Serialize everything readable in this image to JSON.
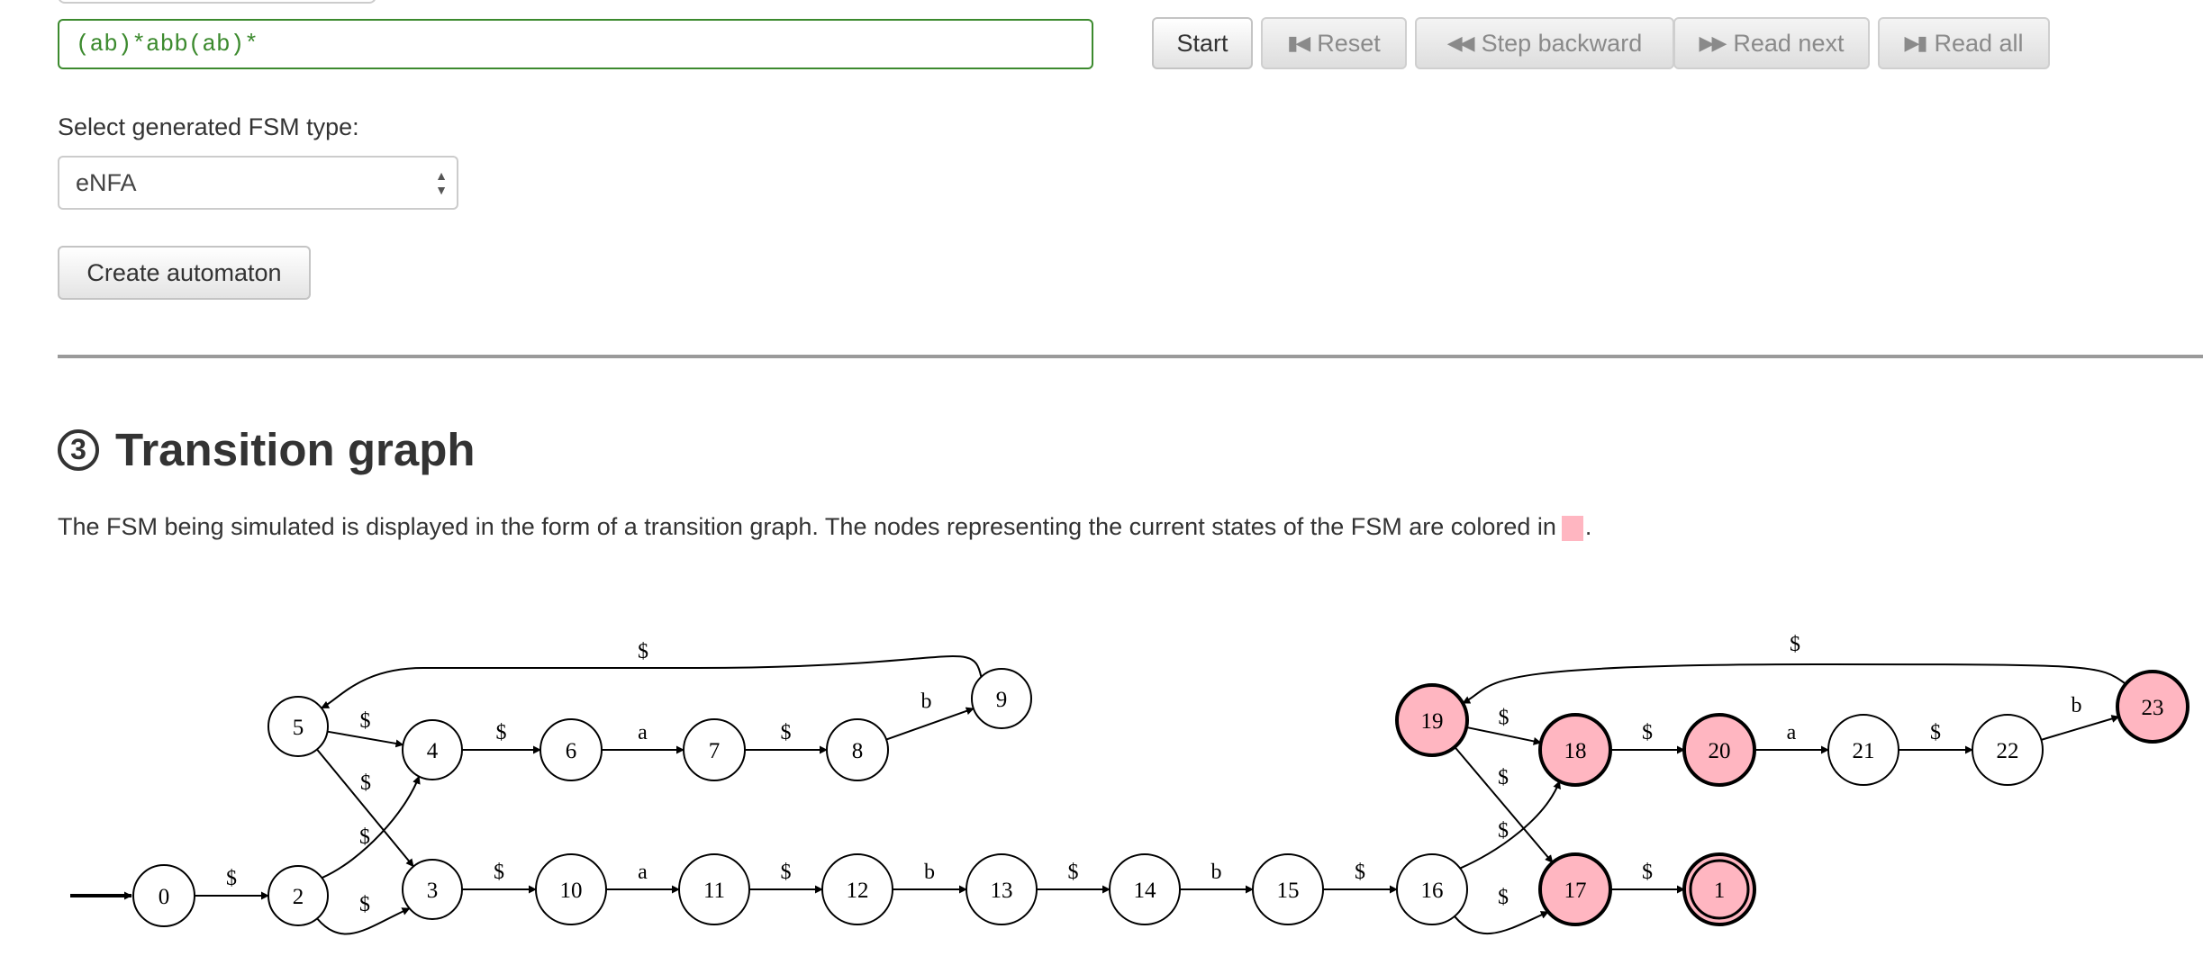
{
  "regex_input": {
    "value": "(ab)*abb(ab)*"
  },
  "controls": {
    "start": "Start",
    "reset": "Reset",
    "step_backward": "Step backward",
    "read_next": "Read next",
    "read_all": "Read all"
  },
  "fsm_type": {
    "label": "Select generated FSM type:",
    "selected": "eNFA"
  },
  "create_button": "Create automaton",
  "section": {
    "number": "③",
    "title": "Transition graph",
    "description": "The FSM being simulated is displayed in the form of a transition graph. The nodes representing the current states of the FSM are colored in",
    "description_end": "."
  },
  "colors": {
    "current_state": "#ffb6c1",
    "accent_green": "#3c8a2e"
  },
  "graph": {
    "nodes": [
      {
        "id": "0",
        "current": false,
        "accepting": false
      },
      {
        "id": "2",
        "current": false,
        "accepting": false
      },
      {
        "id": "5",
        "current": false,
        "accepting": false
      },
      {
        "id": "4",
        "current": false,
        "accepting": false
      },
      {
        "id": "6",
        "current": false,
        "accepting": false
      },
      {
        "id": "7",
        "current": false,
        "accepting": false
      },
      {
        "id": "8",
        "current": false,
        "accepting": false
      },
      {
        "id": "9",
        "current": false,
        "accepting": false
      },
      {
        "id": "3",
        "current": false,
        "accepting": false
      },
      {
        "id": "10",
        "current": false,
        "accepting": false
      },
      {
        "id": "11",
        "current": false,
        "accepting": false
      },
      {
        "id": "12",
        "current": false,
        "accepting": false
      },
      {
        "id": "13",
        "current": false,
        "accepting": false
      },
      {
        "id": "14",
        "current": false,
        "accepting": false
      },
      {
        "id": "15",
        "current": false,
        "accepting": false
      },
      {
        "id": "16",
        "current": false,
        "accepting": false
      },
      {
        "id": "19",
        "current": true,
        "accepting": false
      },
      {
        "id": "18",
        "current": true,
        "accepting": false
      },
      {
        "id": "20",
        "current": true,
        "accepting": false
      },
      {
        "id": "21",
        "current": false,
        "accepting": false
      },
      {
        "id": "22",
        "current": false,
        "accepting": false
      },
      {
        "id": "23",
        "current": true,
        "accepting": false
      },
      {
        "id": "17",
        "current": true,
        "accepting": false
      },
      {
        "id": "1",
        "current": true,
        "accepting": true
      }
    ],
    "edges": [
      {
        "from": "0",
        "to": "2",
        "label": "$"
      },
      {
        "from": "2",
        "to": "4",
        "label": "$"
      },
      {
        "from": "2",
        "to": "3",
        "label": "$"
      },
      {
        "from": "5",
        "to": "4",
        "label": "$"
      },
      {
        "from": "5",
        "to": "3",
        "label": "$"
      },
      {
        "from": "4",
        "to": "6",
        "label": "$"
      },
      {
        "from": "6",
        "to": "7",
        "label": "a"
      },
      {
        "from": "7",
        "to": "8",
        "label": "$"
      },
      {
        "from": "8",
        "to": "9",
        "label": "b"
      },
      {
        "from": "9",
        "to": "5",
        "label": "$"
      },
      {
        "from": "3",
        "to": "10",
        "label": "$"
      },
      {
        "from": "10",
        "to": "11",
        "label": "a"
      },
      {
        "from": "11",
        "to": "12",
        "label": "$"
      },
      {
        "from": "12",
        "to": "13",
        "label": "b"
      },
      {
        "from": "13",
        "to": "14",
        "label": "$"
      },
      {
        "from": "14",
        "to": "15",
        "label": "b"
      },
      {
        "from": "15",
        "to": "16",
        "label": "$"
      },
      {
        "from": "16",
        "to": "18",
        "label": "$"
      },
      {
        "from": "16",
        "to": "17",
        "label": "$"
      },
      {
        "from": "19",
        "to": "18",
        "label": "$"
      },
      {
        "from": "19",
        "to": "17",
        "label": "$"
      },
      {
        "from": "18",
        "to": "20",
        "label": "$"
      },
      {
        "from": "20",
        "to": "21",
        "label": "a"
      },
      {
        "from": "21",
        "to": "22",
        "label": "$"
      },
      {
        "from": "22",
        "to": "23",
        "label": "b"
      },
      {
        "from": "23",
        "to": "19",
        "label": "$"
      },
      {
        "from": "17",
        "to": "1",
        "label": "$"
      }
    ]
  }
}
